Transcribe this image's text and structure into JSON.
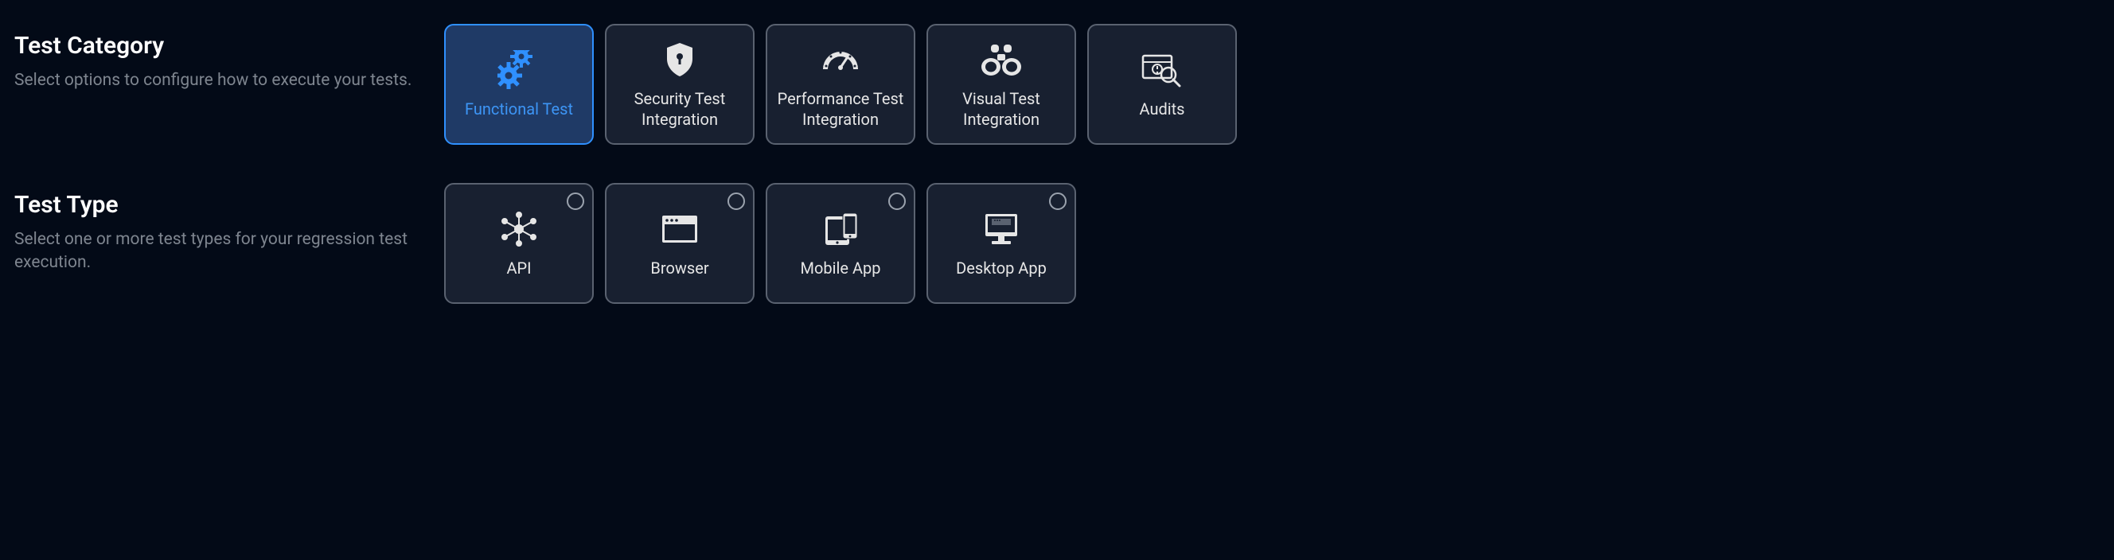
{
  "sections": {
    "category": {
      "title": "Test Category",
      "subtitle": "Select options to configure how to execute your tests.",
      "cards": [
        {
          "label": "Functional Test",
          "icon": "gears-icon",
          "selected": true
        },
        {
          "label": "Security Test Integration",
          "icon": "shield-icon",
          "selected": false
        },
        {
          "label": "Performance Test Integration",
          "icon": "gauge-icon",
          "selected": false
        },
        {
          "label": "Visual Test Integration",
          "icon": "binoculars-icon",
          "selected": false
        },
        {
          "label": "Audits",
          "icon": "audit-icon",
          "selected": false
        }
      ]
    },
    "type": {
      "title": "Test Type",
      "subtitle": "Select one or more test types for your regression test execution.",
      "cards": [
        {
          "label": "API",
          "icon": "api-icon",
          "selected": false
        },
        {
          "label": "Browser",
          "icon": "browser-icon",
          "selected": false
        },
        {
          "label": "Mobile App",
          "icon": "mobile-icon",
          "selected": false
        },
        {
          "label": "Desktop App",
          "icon": "desktop-icon",
          "selected": false
        }
      ]
    }
  }
}
